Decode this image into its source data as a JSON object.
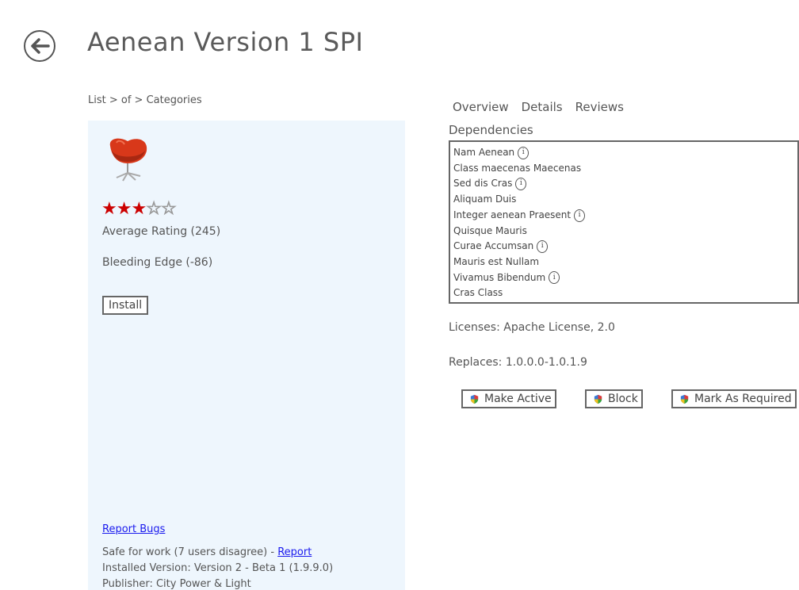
{
  "header": {
    "title": "Aenean Version 1 SPI",
    "breadcrumb": "List > of > Categories"
  },
  "product": {
    "rating_stars": 3,
    "rating_max": 5,
    "average_rating": "Average Rating (245)",
    "bleeding_edge": "Bleeding Edge (-86)",
    "install_label": "Install",
    "report_bugs": "Report Bugs",
    "safe_text": "Safe for work (7 users disagree) - ",
    "report_link": "Report",
    "installed_version": "Installed Version: Version 2 - Beta 1 (1.9.9.0)",
    "publisher": "Publisher: City Power & Light"
  },
  "tabs": [
    "Overview",
    "Details",
    "Reviews"
  ],
  "dependencies": {
    "label": "Dependencies",
    "items": [
      {
        "name": "Nam Aenean",
        "info": true
      },
      {
        "name": "Class maecenas Maecenas",
        "info": false
      },
      {
        "name": "Sed dis Cras",
        "info": true
      },
      {
        "name": "Aliquam Duis",
        "info": false
      },
      {
        "name": "Integer aenean Praesent",
        "info": true
      },
      {
        "name": "Quisque Mauris",
        "info": false
      },
      {
        "name": "Curae Accumsan",
        "info": true
      },
      {
        "name": "Mauris est Nullam",
        "info": false
      },
      {
        "name": "Vivamus Bibendum",
        "info": true
      },
      {
        "name": "Cras Class",
        "info": false
      }
    ]
  },
  "licenses": "Licenses: Apache License, 2.0",
  "replaces": "Replaces: 1.0.0.0-1.0.1.9",
  "actions": {
    "make_active": "Make Active",
    "block": "Block",
    "mark_required": "Mark As Required"
  },
  "colors": {
    "panel_bg": "#eef6fd",
    "star_on": "#cc0000",
    "link": "#1a1aee"
  },
  "icons": {
    "back": "arrow-left-circle-icon",
    "info": "info-icon",
    "shield": "shield-icon"
  }
}
